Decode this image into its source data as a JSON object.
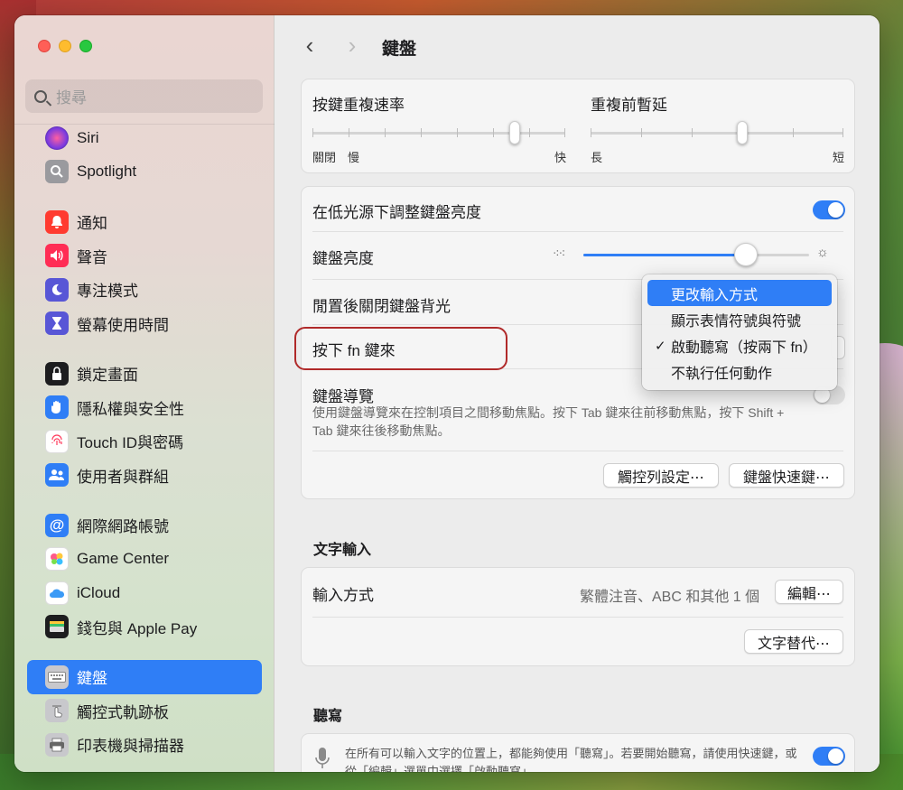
{
  "sidebar": {
    "search_placeholder": "搜尋",
    "items": [
      {
        "label": "Siri",
        "icon": "siri-icon",
        "color": "#8a3ad0"
      },
      {
        "label": "Spotlight",
        "icon": "spotlight-icon",
        "color": "#8e8e93"
      },
      {
        "label": "通知",
        "icon": "bell-icon",
        "color": "#ff3b30"
      },
      {
        "label": "聲音",
        "icon": "speaker-icon",
        "color": "#ff2d55"
      },
      {
        "label": "專注模式",
        "icon": "moon-icon",
        "color": "#5856d6"
      },
      {
        "label": "螢幕使用時間",
        "icon": "hourglass-icon",
        "color": "#5856d6"
      },
      {
        "label": "鎖定畫面",
        "icon": "lock-icon",
        "color": "#1d1d1f"
      },
      {
        "label": "隱私權與安全性",
        "icon": "hand-icon",
        "color": "#2f7ef6"
      },
      {
        "label": "Touch ID與密碼",
        "icon": "fingerprint-icon",
        "color": "#ffffff"
      },
      {
        "label": "使用者與群組",
        "icon": "users-icon",
        "color": "#2f7ef6"
      },
      {
        "label": "網際網路帳號",
        "icon": "at-icon",
        "color": "#2f7ef6"
      },
      {
        "label": "Game Center",
        "icon": "game-center-icon",
        "color": "#ffffff"
      },
      {
        "label": "iCloud",
        "icon": "cloud-icon",
        "color": "#ffffff"
      },
      {
        "label": "錢包與 Apple Pay",
        "icon": "wallet-icon",
        "color": "#1d1d1f"
      },
      {
        "label": "鍵盤",
        "icon": "keyboard-icon",
        "color": "#8e8e93"
      },
      {
        "label": "觸控式軌跡板",
        "icon": "trackpad-icon",
        "color": "#8e8e93"
      },
      {
        "label": "印表機與掃描器",
        "icon": "printer-icon",
        "color": "#8e8e93"
      }
    ]
  },
  "header": {
    "title": "鍵盤",
    "back": "‹",
    "forward": "›"
  },
  "repeat": {
    "rate_label": "按鍵重複速率",
    "rate_off": "關閉",
    "rate_slow": "慢",
    "rate_fast": "快",
    "rate_value": 0.8,
    "delay_label": "重複前暫延",
    "delay_long": "長",
    "delay_short": "短",
    "delay_value": 0.6
  },
  "backlight": {
    "auto_label": "在低光源下調整鍵盤亮度",
    "auto_on": true,
    "brightness_label": "鍵盤亮度",
    "brightness_value": 0.72,
    "idle_label": "閒置後關閉鍵盤背光",
    "fn_label": "按下 fn 鍵來",
    "nav_label": "鍵盤導覽",
    "nav_desc": "使用鍵盤導覽來在控制項目之間移動焦點。按下 Tab 鍵來往前移動焦點，按下 Shift + Tab 鍵來往後移動焦點。",
    "nav_on": false,
    "touchbar_button": "觸控列設定⋯",
    "shortcuts_button": "鍵盤快速鍵⋯"
  },
  "text_input": {
    "section": "文字輸入",
    "input_label": "輸入方式",
    "input_value": "繁體注音、ABC 和其他 1 個",
    "edit_button": "編輯⋯",
    "replace_button": "文字替代⋯"
  },
  "dictation": {
    "section": "聽寫",
    "desc": "在所有可以輸入文字的位置上，都能夠使用「聽寫」。若要開始聽寫，請使用快速鍵，或從「編輯」選單中選擇「啟動聽寫」。",
    "on": true
  },
  "fn_menu": {
    "items": [
      {
        "label": "更改輸入方式",
        "selected": true,
        "checked": false
      },
      {
        "label": "顯示表情符號與符號",
        "selected": false,
        "checked": false
      },
      {
        "label": "啟動聽寫（按兩下 fn）",
        "selected": false,
        "checked": true
      },
      {
        "label": "不執行任何動作",
        "selected": false,
        "checked": false
      }
    ],
    "check_mark": "✓"
  }
}
